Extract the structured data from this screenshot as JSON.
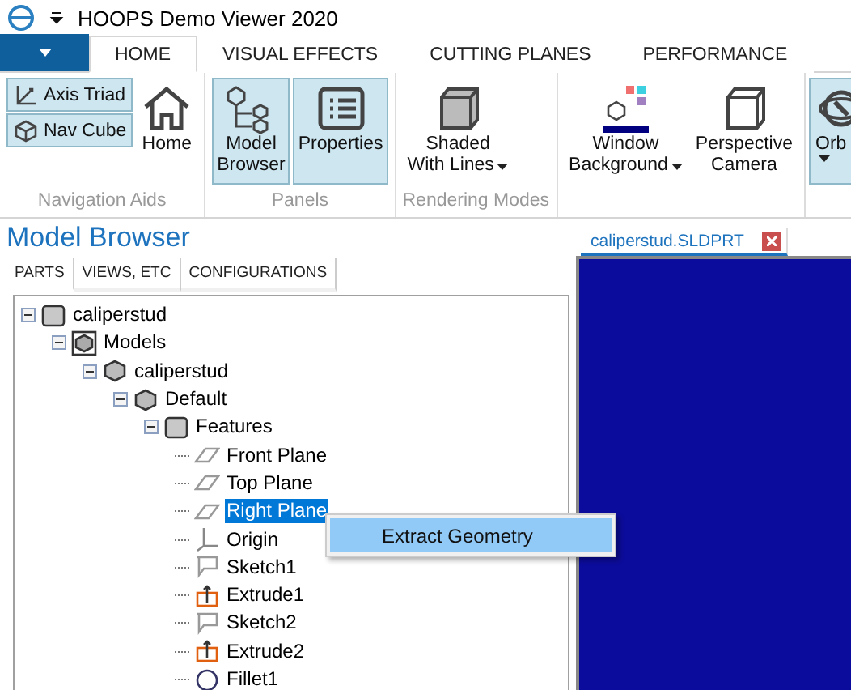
{
  "window": {
    "title": "HOOPS Demo Viewer 2020"
  },
  "ribbon_tabs": [
    {
      "label": "HOME",
      "selected": true
    },
    {
      "label": "VISUAL EFFECTS",
      "selected": false
    },
    {
      "label": "CUTTING PLANES",
      "selected": false
    },
    {
      "label": "PERFORMANCE",
      "selected": false
    }
  ],
  "ribbon_groups": [
    {
      "label": "Navigation Aids",
      "buttons": [
        {
          "kind": "small",
          "label": "Axis Triad",
          "on": true
        },
        {
          "kind": "small",
          "label": "Nav Cube",
          "on": true
        },
        {
          "kind": "large",
          "label": "Home",
          "on": false
        }
      ]
    },
    {
      "label": "Panels",
      "buttons": [
        {
          "kind": "large",
          "label": "Model\nBrowser",
          "on": true
        },
        {
          "kind": "large",
          "label": "Properties",
          "on": true
        }
      ]
    },
    {
      "label": "Rendering Modes",
      "buttons": [
        {
          "kind": "large",
          "label": "Shaded\nWith Lines",
          "on": false,
          "dropdown": true
        }
      ]
    },
    {
      "buttons": [
        {
          "kind": "large",
          "label": "Window\nBackground",
          "on": false,
          "dropdown": true
        },
        {
          "kind": "large",
          "label": "Perspective\nCamera",
          "on": false
        }
      ]
    },
    {
      "buttons": [
        {
          "kind": "large",
          "label": "Orb",
          "on": true,
          "dropdown": true,
          "clipped": true
        }
      ]
    }
  ],
  "model_browser": {
    "title": "Model Browser",
    "tabs": [
      {
        "label": "PARTS",
        "selected": true
      },
      {
        "label": "VIEWS, ETC",
        "selected": false
      },
      {
        "label": "CONFIGURATIONS",
        "selected": false
      }
    ],
    "tree": [
      {
        "label": "caliperstud",
        "kind": "folder",
        "selected": false,
        "expanded": true,
        "children": [
          {
            "label": "Models",
            "kind": "assembly",
            "selected": false,
            "expanded": true,
            "children": [
              {
                "label": "caliperstud",
                "kind": "part",
                "selected": false,
                "expanded": true,
                "children": [
                  {
                    "label": "Default",
                    "kind": "part",
                    "selected": false,
                    "expanded": true,
                    "children": [
                      {
                        "label": "Features",
                        "kind": "folder",
                        "selected": false,
                        "expanded": true,
                        "children": [
                          {
                            "label": "Front Plane",
                            "kind": "plane",
                            "selected": false
                          },
                          {
                            "label": "Top Plane",
                            "kind": "plane",
                            "selected": false
                          },
                          {
                            "label": "Right Plane",
                            "kind": "plane",
                            "selected": true
                          },
                          {
                            "label": "Origin",
                            "kind": "origin",
                            "selected": false
                          },
                          {
                            "label": "Sketch1",
                            "kind": "sketch",
                            "selected": false
                          },
                          {
                            "label": "Extrude1",
                            "kind": "extrude",
                            "selected": false
                          },
                          {
                            "label": "Sketch2",
                            "kind": "sketch",
                            "selected": false
                          },
                          {
                            "label": "Extrude2",
                            "kind": "extrude",
                            "selected": false
                          },
                          {
                            "label": "Fillet1",
                            "kind": "fillet",
                            "selected": false
                          }
                        ]
                      }
                    ]
                  }
                ]
              }
            ]
          }
        ]
      }
    ]
  },
  "context_menu": {
    "items": [
      {
        "label": "Extract Geometry",
        "selected": true
      }
    ]
  },
  "document_tab": {
    "title": "caliperstud.SLDPRT"
  }
}
